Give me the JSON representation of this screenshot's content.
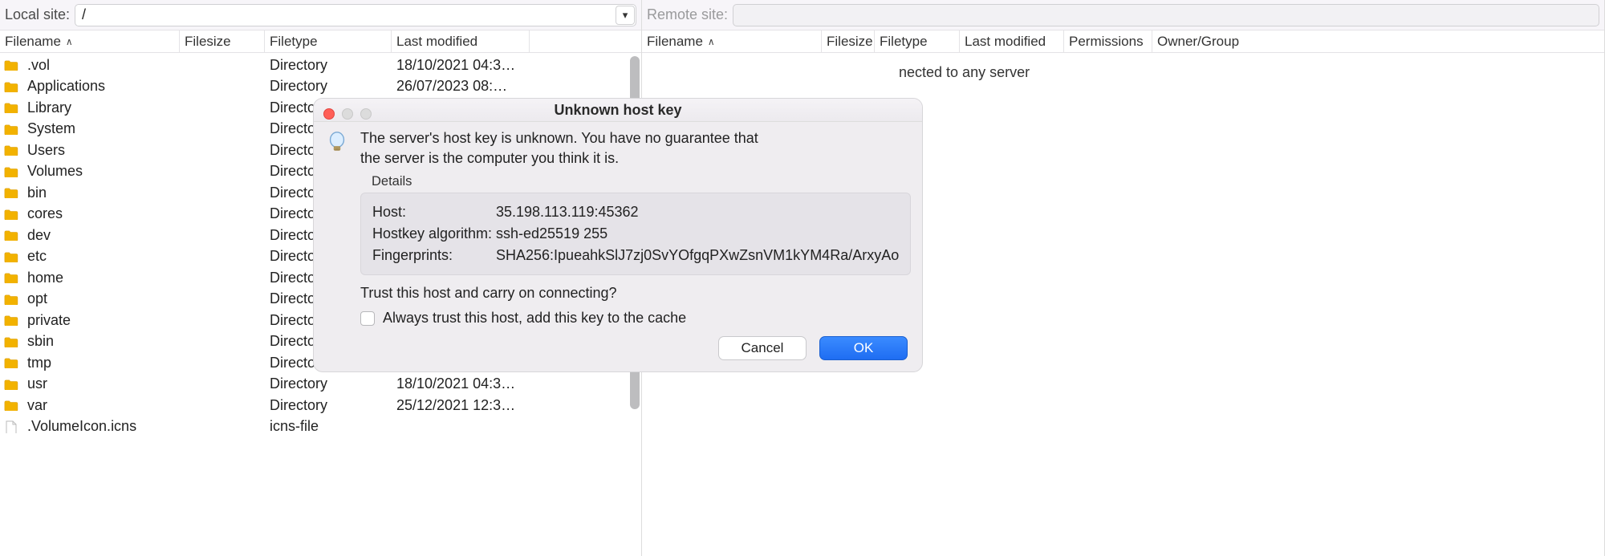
{
  "local": {
    "label": "Local site:",
    "path": "/",
    "headers": {
      "filename": "Filename",
      "filesize": "Filesize",
      "filetype": "Filetype",
      "lastmod": "Last modified"
    },
    "rows": [
      {
        "name": ".vol",
        "type": "Directory",
        "mod": "18/10/2021 04:3…",
        "icon": "folder"
      },
      {
        "name": "Applications",
        "type": "Directory",
        "mod": "26/07/2023 08:…",
        "icon": "folder"
      },
      {
        "name": "Library",
        "type": "Directo",
        "mod": "",
        "icon": "folder"
      },
      {
        "name": "System",
        "type": "Directo",
        "mod": "",
        "icon": "folder"
      },
      {
        "name": "Users",
        "type": "Directo",
        "mod": "",
        "icon": "folder"
      },
      {
        "name": "Volumes",
        "type": "Directo",
        "mod": "",
        "icon": "folder"
      },
      {
        "name": "bin",
        "type": "Directo",
        "mod": "",
        "icon": "folder"
      },
      {
        "name": "cores",
        "type": "Directo",
        "mod": "",
        "icon": "folder"
      },
      {
        "name": "dev",
        "type": "Directo",
        "mod": "",
        "icon": "folder"
      },
      {
        "name": "etc",
        "type": "Directo",
        "mod": "",
        "icon": "folder"
      },
      {
        "name": "home",
        "type": "Directo",
        "mod": "",
        "icon": "folder"
      },
      {
        "name": "opt",
        "type": "Directo",
        "mod": "",
        "icon": "folder"
      },
      {
        "name": "private",
        "type": "Directo",
        "mod": "",
        "icon": "folder"
      },
      {
        "name": "sbin",
        "type": "Directo",
        "mod": "",
        "icon": "folder"
      },
      {
        "name": "tmp",
        "type": "Directo",
        "mod": "",
        "icon": "folder"
      },
      {
        "name": "usr",
        "type": "Directory",
        "mod": "18/10/2021 04:3…",
        "icon": "folder"
      },
      {
        "name": "var",
        "type": "Directory",
        "mod": "25/12/2021 12:3…",
        "icon": "folder"
      },
      {
        "name": ".VolumeIcon.icns",
        "type": "icns-file",
        "mod": "",
        "icon": "file"
      }
    ]
  },
  "remote": {
    "label": "Remote site:",
    "path": "",
    "headers": {
      "filename": "Filename",
      "filesize": "Filesize",
      "filetype": "Filetype",
      "lastmod": "Last modified",
      "permissions": "Permissions",
      "owner": "Owner/Group"
    },
    "empty_message": "Not connected to any server",
    "empty_message_visible": "nected to any server"
  },
  "dialog": {
    "title": "Unknown host key",
    "message_l1": "The server's host key is unknown. You have no guarantee that",
    "message_l2": "the server is the computer you think it is.",
    "details_label": "Details",
    "host_label": "Host:",
    "host_value": "35.198.113.119:45362",
    "algo_label": "Hostkey algorithm:",
    "algo_value": "ssh-ed25519 255",
    "fp_label": "Fingerprints:",
    "fp_value": "SHA256:IpueahkSlJ7zj0SvYOfgqPXwZsnVM1kYM4Ra/ArxyAo",
    "trust_question": "Trust this host and carry on connecting?",
    "always_trust_label": "Always trust this host, add this key to the cache",
    "cancel": "Cancel",
    "ok": "OK"
  },
  "colors": {
    "accent": "#1f6df2",
    "folder": "#f2b200"
  }
}
